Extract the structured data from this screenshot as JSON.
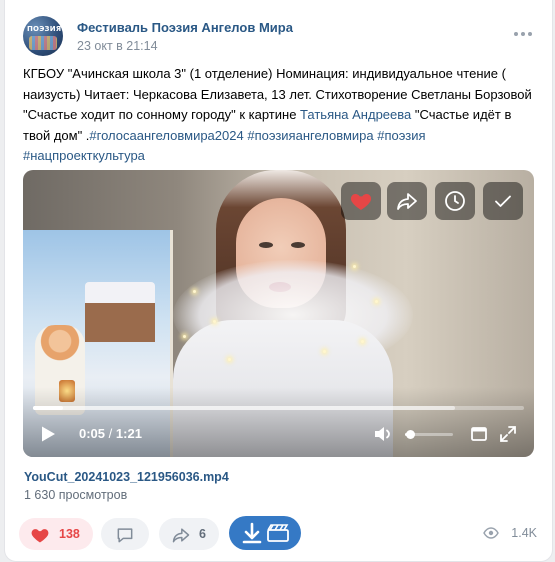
{
  "post": {
    "group_name": "Фестиваль Поэзия Ангелов Мира",
    "avatar_text": "ПОЭЗИЯ",
    "date": "23 окт в 21:14",
    "text_main": "КГБОУ \"Ачинская школа 3\" (1 отделение) Номинация: индивидуальное чтение ( наизусть) Читает: Черкасова Елизавета, 13 лет. Стихотворение Светланы Борзовой \"Счастье ходит по сонному городу\" к картине ",
    "author_link": "Татьяна Андреева",
    "text_after_link": " \"Счастье идёт в твой дом\" .",
    "hashtag_1": "#голосаангеловмира2024",
    "hashtag_2": "#поэзияангеловмира",
    "hashtag_3": "#поэзия",
    "hashtag_4": "#нацпроекткультура"
  },
  "video": {
    "current_time": "0:05",
    "separator": "/",
    "duration": "1:21",
    "progress_fraction": 0.062,
    "buffered_fraction": 0.86,
    "volume_fraction": 0.1,
    "file_name": "YouCut_20241023_121956036.mp4",
    "views_text": "1 630 просмотров",
    "icons": [
      "heart-icon",
      "share-icon",
      "watch-later-icon",
      "check-icon",
      "play-icon",
      "volume-icon",
      "miniplayer-icon",
      "fullscreen-icon"
    ]
  },
  "actions": {
    "likes": "138",
    "shares": "6",
    "views": "1.4K"
  },
  "colors": {
    "link": "#2a5885",
    "like": "#e64646",
    "download": "#3579c5",
    "muted": "#818c99"
  }
}
